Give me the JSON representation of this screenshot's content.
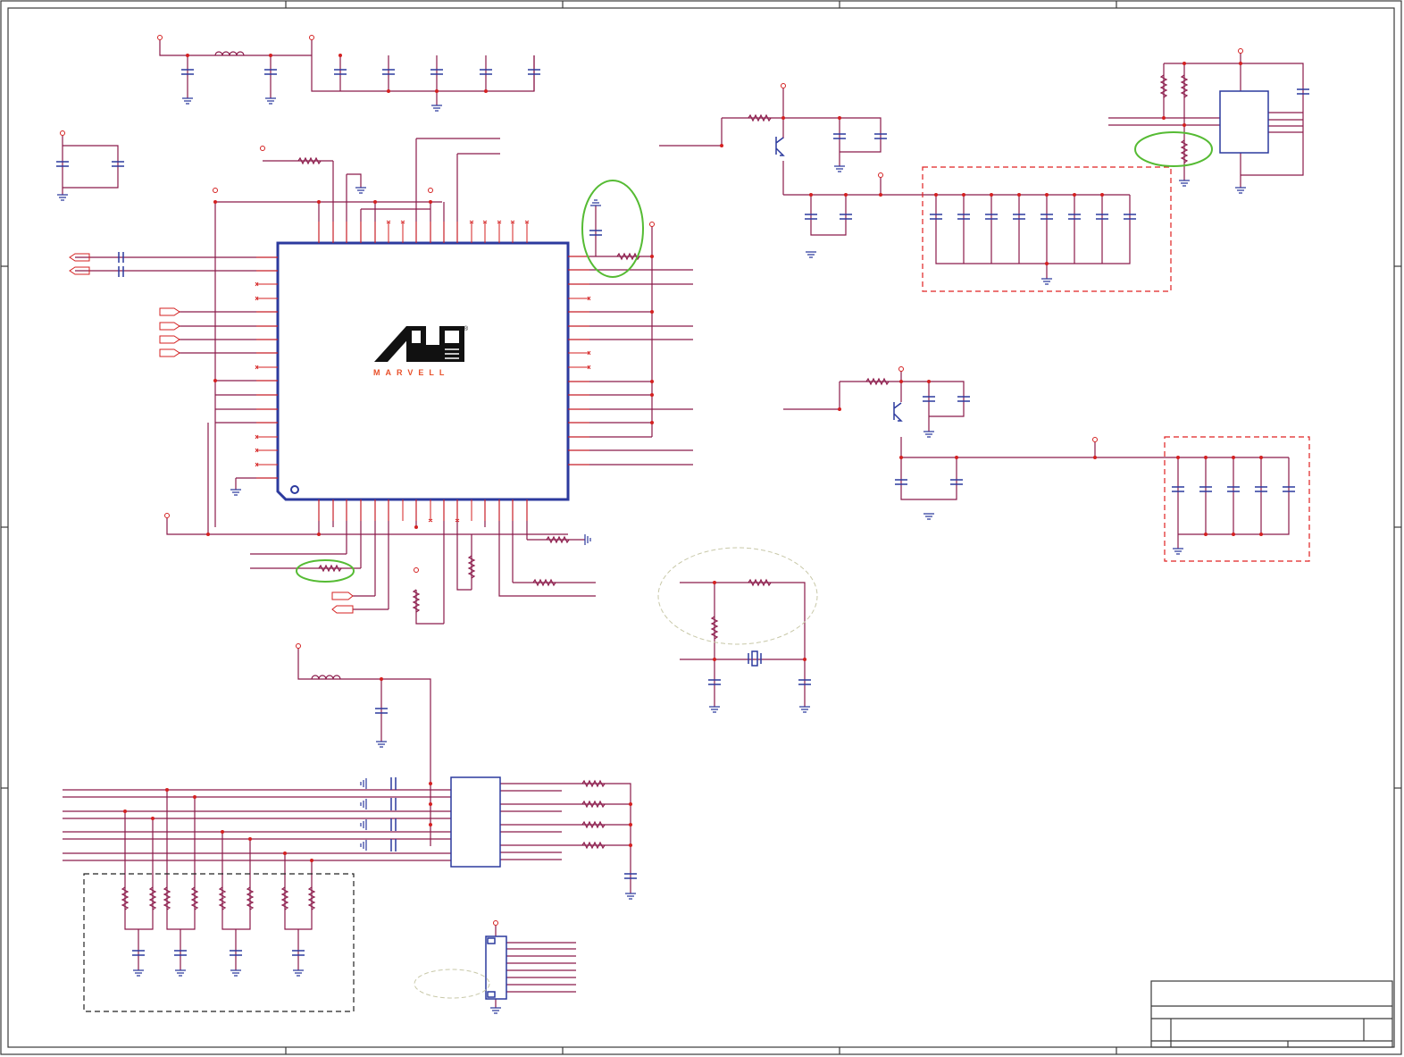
{
  "drawing": {
    "manufacturer_logo": {
      "text": "MARVELL",
      "registered_mark": "®",
      "color": "#e8502a"
    },
    "colors": {
      "frame": "#3a3a3a",
      "wire": "#8b1a4a",
      "pin": "#d42020",
      "component": "#2c3a9e",
      "highlight": "#55bb33",
      "dashed_box_red": "#e02020",
      "dashed_box_black": "#222222",
      "note_ellipse": "#c8c8a8"
    }
  }
}
